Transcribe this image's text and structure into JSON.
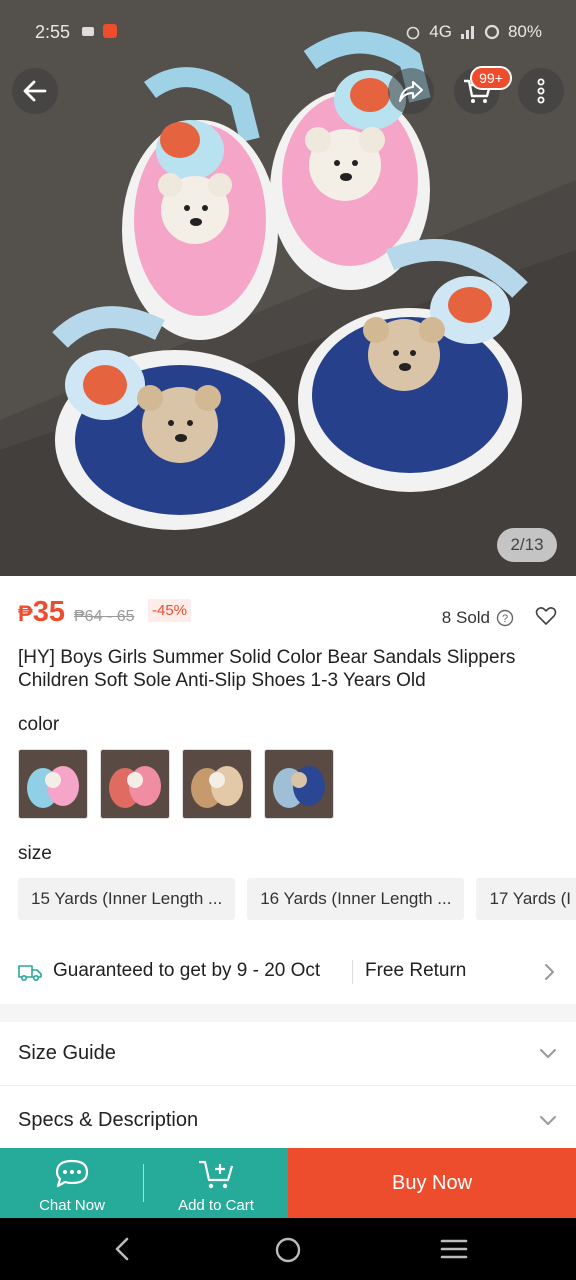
{
  "status_bar": {
    "time": "2:55",
    "network": "4G",
    "battery": "80%"
  },
  "top_bar": {
    "back_icon": "arrow-left-icon",
    "share_icon": "share-icon",
    "cart_icon": "cart-icon",
    "cart_badge": "99+",
    "more_icon": "more-vertical-icon"
  },
  "image_counter": "2/13",
  "product": {
    "currency": "₱",
    "price": "35",
    "original_price": "₱64 - 65",
    "discount": "-45%",
    "sold": "8 Sold",
    "title": "[HY] Boys Girls Summer Solid Color Bear Sandals Slippers Children Soft Sole Anti-Slip Shoes 1-3 Years Old"
  },
  "variations": {
    "color_label": "color",
    "colors": [
      "blue-pink",
      "red-pink",
      "brown-khaki",
      "navy-blue"
    ],
    "size_label": "size",
    "sizes": [
      "15 Yards (Inner Length ...",
      "16 Yards (Inner Length ...",
      "17 Yards (I"
    ]
  },
  "delivery": {
    "text": "Guaranteed to get by 9 - 20 Oct",
    "return": "Free Return"
  },
  "sections": {
    "size_guide": "Size Guide",
    "specs": "Specs & Description"
  },
  "actions": {
    "chat": "Chat Now",
    "add_to_cart": "Add to Cart",
    "buy_now": "Buy Now"
  },
  "colors": {
    "brand": "#ee4d2d",
    "teal": "#26aa99"
  }
}
